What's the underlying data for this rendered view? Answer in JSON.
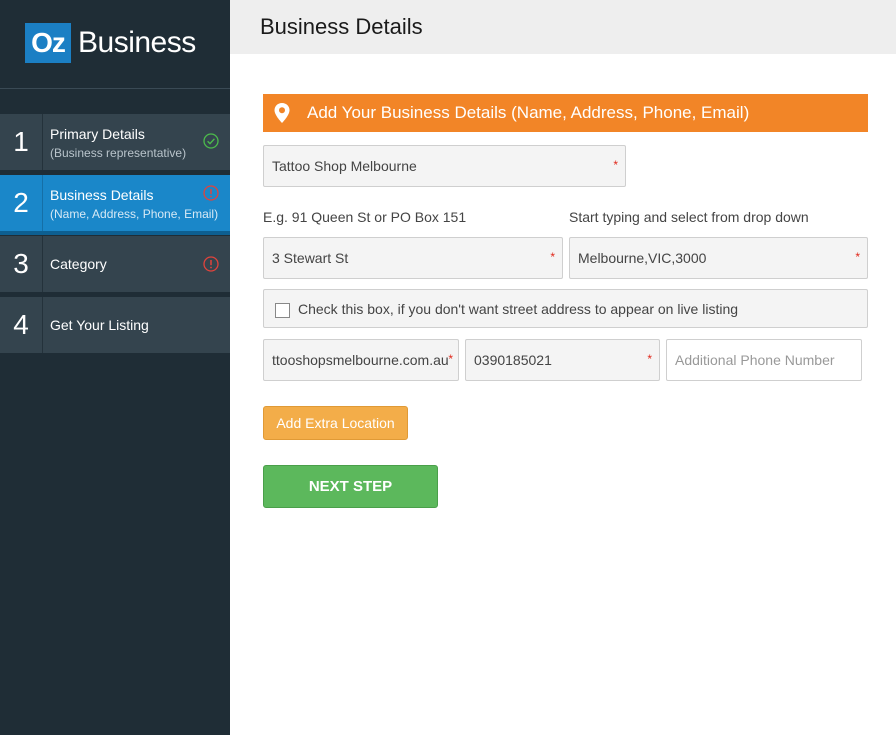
{
  "brand": {
    "mark": "Oz",
    "name": "Business"
  },
  "steps": [
    {
      "num": "1",
      "title": "Primary Details",
      "sub": "(Business representative)",
      "status": "complete"
    },
    {
      "num": "2",
      "title": "Business Details",
      "sub": "(Name, Address, Phone, Email)",
      "status": "warning"
    },
    {
      "num": "3",
      "title": "Category",
      "sub": "",
      "status": "warning"
    },
    {
      "num": "4",
      "title": "Get Your Listing",
      "sub": "",
      "status": "none"
    }
  ],
  "header": {
    "title": "Business Details"
  },
  "banner": {
    "icon": "map-pin-icon",
    "text": "Add Your Business Details (Name, Address, Phone, Email)"
  },
  "form": {
    "business_name": "Tattoo Shop Melbourne",
    "street_hint": "E.g. 91 Queen St or PO Box 151",
    "suburb_hint": "Start typing and select from drop down",
    "street": "3 Stewart St",
    "suburb": "Melbourne,VIC,3000",
    "hide_address_label": "Check this box, if you don't want street address to appear on live listing",
    "hide_address_checked": false,
    "website": "ttooshopsmelbourne.com.au",
    "phone": "0390185021",
    "additional_phone_placeholder": "Additional Phone Number",
    "required_mark": "*"
  },
  "buttons": {
    "add_location": "Add Extra Location",
    "next": "NEXT STEP"
  },
  "colors": {
    "sidebar": "#1f2d36",
    "step": "#34444e",
    "active_step": "#1a87c9",
    "banner": "#f28527",
    "next_button": "#5cb85c",
    "extra_button": "#f3ad49",
    "complete": "#4cbb4c",
    "warning": "#e0433c"
  }
}
